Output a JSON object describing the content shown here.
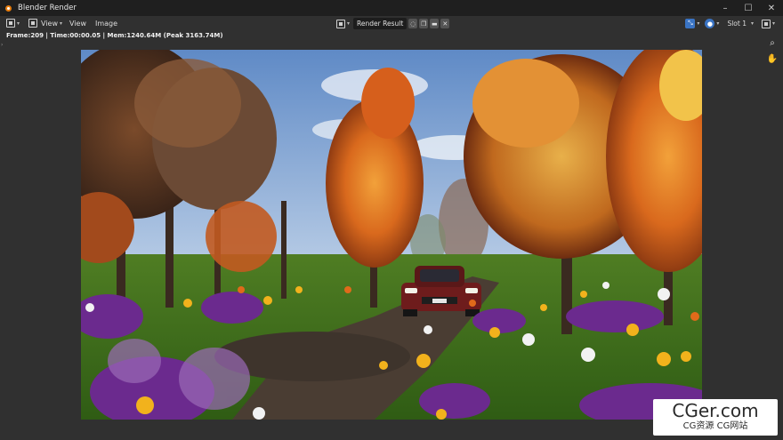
{
  "window": {
    "title": "Blender Render",
    "controls": [
      "–",
      "☐",
      "✕"
    ]
  },
  "header": {
    "view_menu": "View",
    "menus": [
      "View",
      "Image"
    ],
    "image_name": "Render Result",
    "slot": "Slot 1"
  },
  "stats": "Frame:209 | Time:00:00.05 | Mem:1240.64M (Peak 3163.74M)",
  "watermark": {
    "main": "CGer.com",
    "sub": "CG资源  CG网站"
  },
  "colors": {
    "accent_blue": "#3a74c4",
    "panel_bg": "#303030",
    "titlebar_bg": "#1f1f1f"
  }
}
